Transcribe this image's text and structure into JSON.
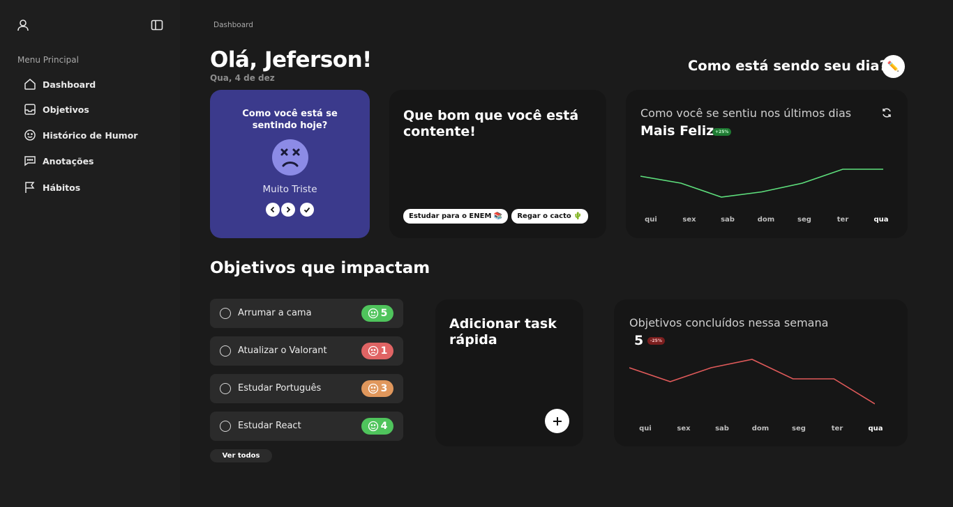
{
  "breadcrumb": "Dashboard",
  "sidebar": {
    "heading": "Menu Principal",
    "items": [
      {
        "label": "Dashboard",
        "icon": "home-icon"
      },
      {
        "label": "Objetivos",
        "icon": "inbox-icon"
      },
      {
        "label": "Histórico de Humor",
        "icon": "smiley-icon"
      },
      {
        "label": "Anotações",
        "icon": "message-icon"
      },
      {
        "label": "Hábitos",
        "icon": "flag-icon"
      }
    ]
  },
  "header": {
    "greeting": "Olá, Jeferson!",
    "date": "Qua, 4 de dez",
    "question": "Como está sendo seu dia?",
    "edit_icon": "pencil-icon"
  },
  "mood": {
    "question": "Como você está se sentindo hoje?",
    "label": "Muito Triste",
    "face_color": "#8c8be6",
    "card_color": "#3b3a8c"
  },
  "happy": {
    "title": "Que bom que você está contente!",
    "chips": [
      "Estudar para o ENEM 📚",
      "Regar o cacto 🌵"
    ]
  },
  "mood_chart": {
    "title": "Como você se sentiu nos últimos dias",
    "headline": "Mais Feliz",
    "badge": "+25%",
    "color": "#5ee07d"
  },
  "goals_section": {
    "title": "Objetivos que impactam",
    "see_all": "Ver todos",
    "items": [
      {
        "label": "Arrumar a cama",
        "score": "5",
        "color": "#4fc45c",
        "face": "happy"
      },
      {
        "label": "Atualizar o Valorant",
        "score": "1",
        "color": "#e06464",
        "face": "sad"
      },
      {
        "label": "Estudar Português",
        "score": "3",
        "color": "#e0975c",
        "face": "neutral"
      },
      {
        "label": "Estudar React",
        "score": "4",
        "color": "#4fc45c",
        "face": "happy"
      }
    ]
  },
  "quick_task": {
    "title": "Adicionar task rápida"
  },
  "goals_chart": {
    "title": "Objetivos concluídos nessa semana",
    "headline": "5",
    "badge": "-25%",
    "color": "#e05a5a"
  },
  "chart_data": [
    {
      "type": "line",
      "title": "Como você se sentiu nos últimos dias",
      "categories": [
        "qui",
        "sex",
        "sab",
        "dom",
        "seg",
        "ter",
        "qua"
      ],
      "values": [
        3.0,
        2.6,
        1.8,
        2.1,
        2.6,
        3.4,
        3.4
      ],
      "ylim": [
        1,
        5
      ],
      "grid": false
    },
    {
      "type": "line",
      "title": "Objetivos concluídos nessa semana",
      "categories": [
        "qui",
        "sex",
        "sab",
        "dom",
        "seg",
        "ter",
        "qua"
      ],
      "values": [
        6,
        5.5,
        6,
        6.3,
        5.6,
        5.6,
        4.7
      ],
      "ylim": [
        4,
        7
      ],
      "grid": false
    }
  ]
}
